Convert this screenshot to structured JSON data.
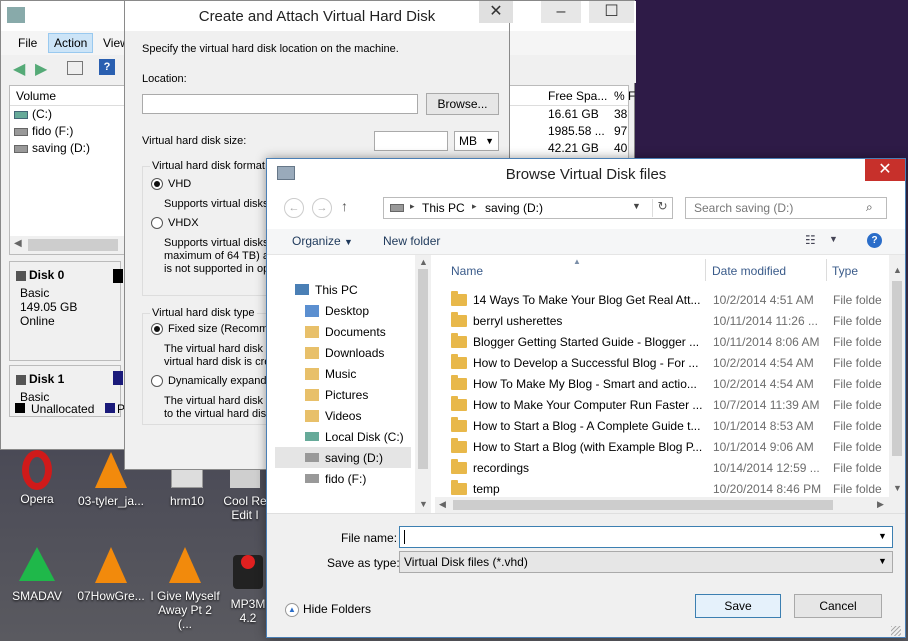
{
  "desktop": {
    "icons": [
      {
        "label": "Opera"
      },
      {
        "label": "03-tyler_ja..."
      },
      {
        "label": "hrm10"
      },
      {
        "label": "Cool Re"
      },
      {
        "label": "Edit I"
      },
      {
        "label": "SMADAV"
      },
      {
        "label": "07HowGre..."
      },
      {
        "label": "I Give Myself"
      },
      {
        "label": "Away Pt 2 (..."
      },
      {
        "label": "MP3M"
      },
      {
        "label": "4.2"
      }
    ]
  },
  "disk_mgmt": {
    "menu": {
      "file": "File",
      "action": "Action",
      "view": "View"
    },
    "columns": {
      "volume": "Volume",
      "free_space": "Free Spa...",
      "percent": "% F"
    },
    "volumes": [
      {
        "name": "(C:)",
        "free": "16.61 GB",
        "pct": "38"
      },
      {
        "name": "fido (F:)",
        "free": "1985.58 ...",
        "pct": "97"
      },
      {
        "name": "saving (D:)",
        "free": "42.21 GB",
        "pct": "40"
      }
    ],
    "disk0": {
      "name": "Disk 0",
      "type": "Basic",
      "size": "149.05 GB",
      "status": "Online"
    },
    "disk1": {
      "name": "Disk 1",
      "type": "Basic"
    },
    "legend": {
      "unallocated": "Unallocated",
      "primary": "P"
    }
  },
  "vhd_dialog": {
    "title": "Create and Attach Virtual Hard Disk",
    "instructions": "Specify the virtual hard disk location on the machine.",
    "location_label": "Location:",
    "location_value": "",
    "browse_label": "Browse...",
    "size_label": "Virtual hard disk size:",
    "size_unit": "MB",
    "format_group": "Virtual hard disk format",
    "vhd": "VHD",
    "vhd_desc": "Supports virtual disks",
    "vhdx": "VHDX",
    "vhdx_desc1": "Supports virtual disks",
    "vhdx_desc2": "maximum of 64 TB) ar",
    "vhdx_desc3": "is not supported in ope",
    "type_group": "Virtual hard disk type",
    "fixed": "Fixed size (Recomme",
    "fixed_desc1": "The virtual hard disk fi",
    "fixed_desc2": "virtual hard disk is crea",
    "dynamic": "Dynamically expandin",
    "dynamic_desc1": "The virtual hard disk fi",
    "dynamic_desc2": "to the virtual hard disk"
  },
  "browse_dialog": {
    "title": "Browse Virtual Disk files",
    "breadcrumb": [
      "This PC",
      "saving (D:)"
    ],
    "search_placeholder": "Search saving (D:)",
    "organize_label": "Organize",
    "new_folder_label": "New folder",
    "nav": [
      {
        "label": "This PC"
      },
      {
        "label": "Desktop"
      },
      {
        "label": "Documents"
      },
      {
        "label": "Downloads"
      },
      {
        "label": "Music"
      },
      {
        "label": "Pictures"
      },
      {
        "label": "Videos"
      },
      {
        "label": "Local Disk (C:)"
      },
      {
        "label": "saving (D:)"
      },
      {
        "label": "fido (F:)"
      }
    ],
    "columns": {
      "name": "Name",
      "date": "Date modified",
      "type": "Type"
    },
    "files": [
      {
        "name": "14 Ways To Make Your Blog Get Real Att...",
        "date": "10/2/2014 4:51 AM",
        "type": "File folde"
      },
      {
        "name": "berryl usherettes",
        "date": "10/11/2014 11:26 ...",
        "type": "File folde"
      },
      {
        "name": "Blogger Getting Started Guide - Blogger ...",
        "date": "10/11/2014 8:06 AM",
        "type": "File folde"
      },
      {
        "name": "How to Develop a Successful Blog - For ...",
        "date": "10/2/2014 4:54 AM",
        "type": "File folde"
      },
      {
        "name": "How To Make My Blog - Smart and actio...",
        "date": "10/2/2014 4:54 AM",
        "type": "File folde"
      },
      {
        "name": "How to Make Your Computer Run Faster ...",
        "date": "10/7/2014 11:39 AM",
        "type": "File folde"
      },
      {
        "name": "How to Start a Blog - A Complete Guide t...",
        "date": "10/1/2014 8:53 AM",
        "type": "File folde"
      },
      {
        "name": "How to Start a Blog (with Example Blog P...",
        "date": "10/1/2014 9:06 AM",
        "type": "File folde"
      },
      {
        "name": "recordings",
        "date": "10/14/2014 12:59 ...",
        "type": "File folde"
      },
      {
        "name": "temp",
        "date": "10/20/2014 8:46 PM",
        "type": "File folde"
      }
    ],
    "filename_label": "File name:",
    "filename_value": "",
    "saveas_label": "Save as type:",
    "saveas_value": "Virtual Disk files (*.vhd)",
    "hide_folders": "Hide Folders",
    "save_label": "Save",
    "cancel_label": "Cancel"
  }
}
